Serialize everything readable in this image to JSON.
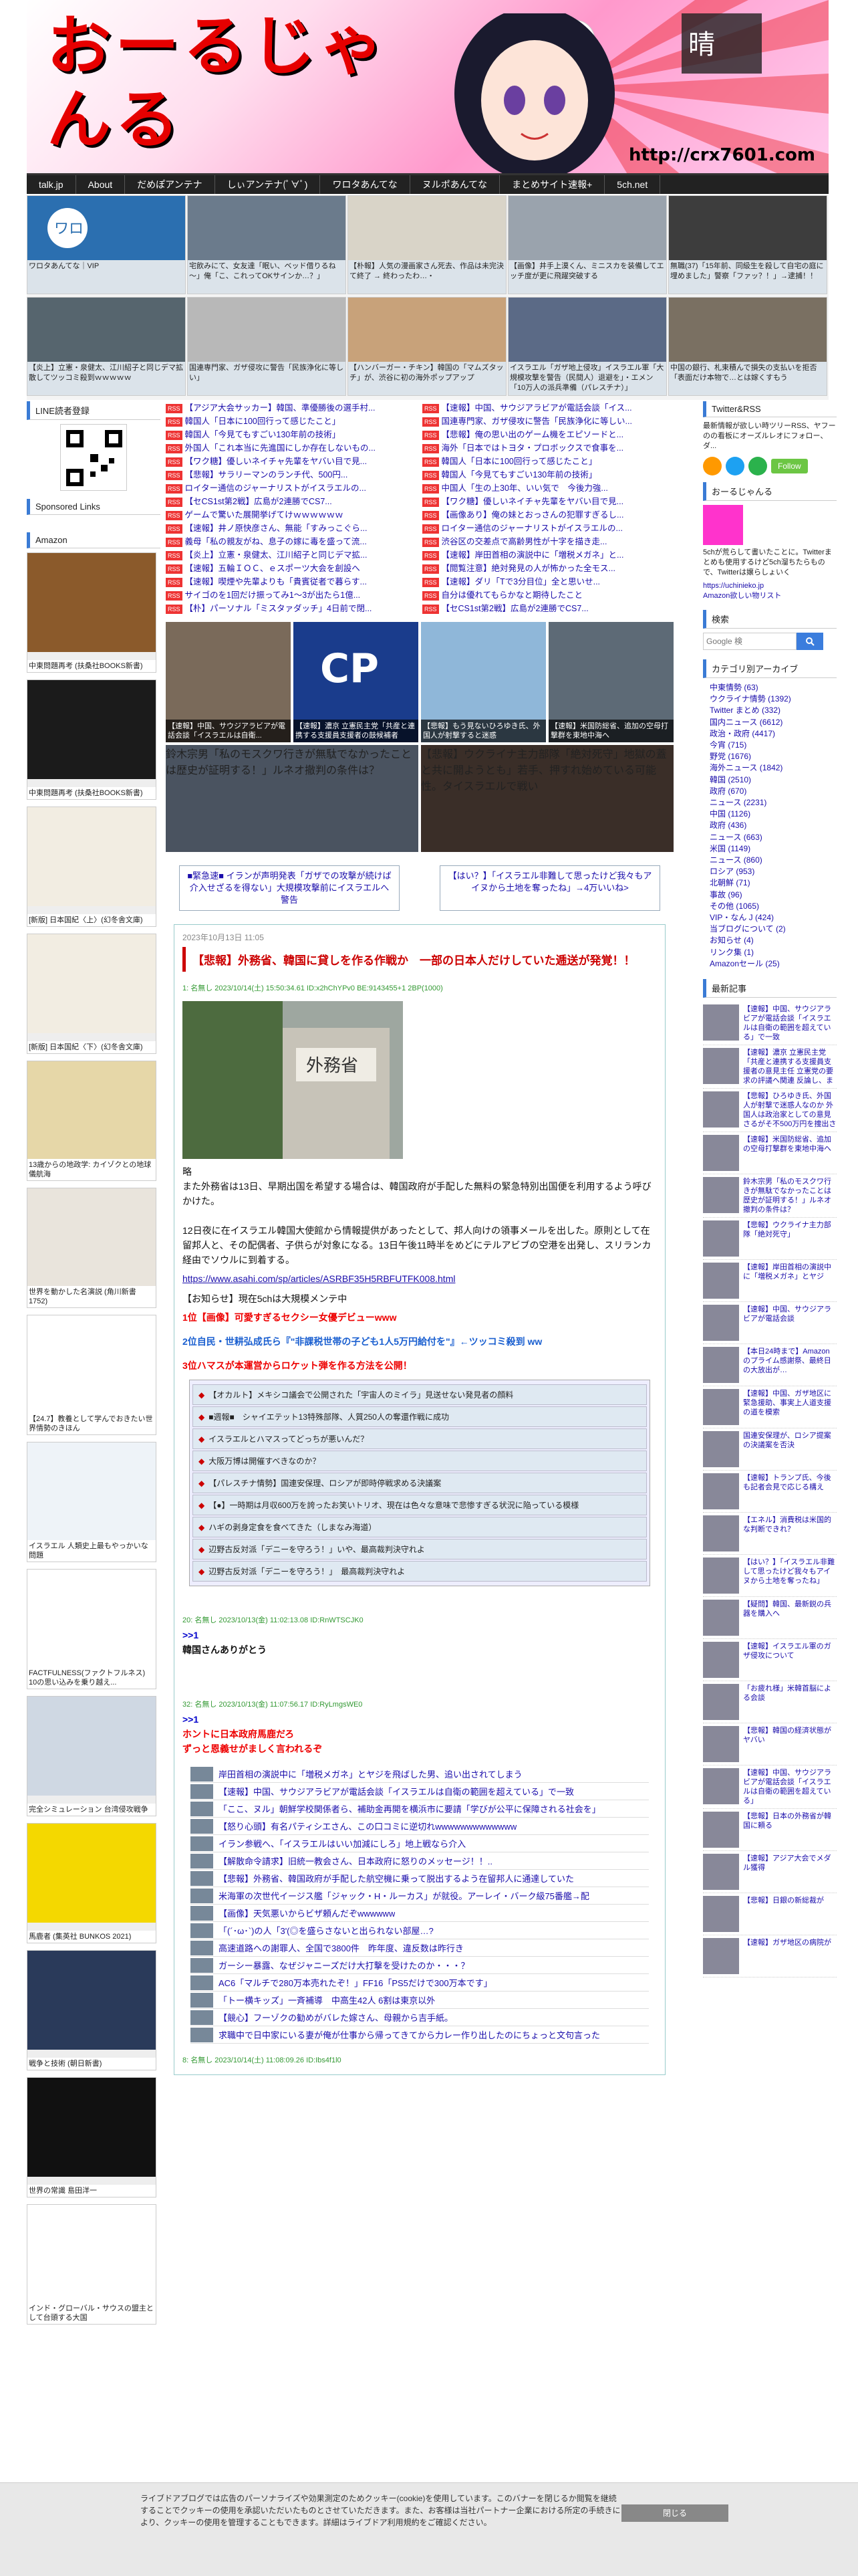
{
  "header": {
    "title": "おーるじゃんる",
    "url": "http://crx7601.com"
  },
  "nav": [
    "talk.jp",
    "About",
    "だめぽアンテナ",
    "しぃアンテナ(ﾟ∀ﾟ)",
    "ワロタあんてな",
    "ヌルポあんてな",
    "まとめサイト速報+",
    "5ch.net"
  ],
  "thumbs": [
    "ワロタあんてな｜VIP",
    "宅飲みにて、女友達「眠い、ベッド借りるね～」俺「こ、これってOKサインか…？」",
    "【朴報】人気の漫画家さん死去、作品は未完決て終了 → 終わったわ…・",
    "【画像】井手上漠くん、ミニスカを装備してエッチ度が更に飛躍突破する",
    "無職(37)「15年前、同級生を殺して自宅の庭に埋めました」警察「ファッ？！」→逮捕！！",
    "【炎上】立憲・泉健太、江川紹子と同じデマ拡散してツッコミ殺到ｗｗｗｗｗ",
    "国連専門家、ガザ侵攻に警告「民族浄化に等しい」",
    "【ハンバーガー・チキン】韓国の「マムズタッチ」が、渋谷に初の海外ポップアップ",
    "イスラエル「ガザ地上侵攻」イスラエル軍「大規模攻撃を警告（民間人）退避を」・エメン「10万人の派兵準備（パレスチナ）」",
    "中国の銀行、札束積んで損失の支払いを拒否「表面だけ本物で…とは嫁くすもう"
  ],
  "left": {
    "line_label": "LINE読者登録",
    "sponsored_label": "Sponsored Links",
    "amazon_label": "Amazon",
    "books": [
      "中東問題再考 (扶桑社BOOKS新書)",
      "中東問題再考 (扶桑社BOOKS新書)",
      "[新版] 日本国紀〈上〉(幻冬舎文庫)",
      "[新版] 日本国紀〈下〉(幻冬舎文庫)",
      "13歳からの地政学: カイゾクとの地球儀航海",
      "世界を動かした名演説 (角川新書 1752)",
      "【24.7】教養として学んでおきたい世界情勢のきほん",
      "イスラエル 人類史上最もやっかいな問題",
      "FACTFULNESS(ファクトフルネス) 10の思い込みを乗り越え...",
      "完全シミュレーション 台湾侵攻戦争",
      "馬鹿者 (集英社 BUNKOS 2021)",
      "戦争と技術 (朝日新書)",
      "世界の常識 島田洋一",
      "インド・グローバル・サウスの盟主として台頭する大国"
    ]
  },
  "headlines": {
    "left": [
      "【アジア大会サッカー】韓国、準優勝後の選手村...",
      "韓国人「日本に100回行って感じたこと」",
      "韓国人「今見てもすごい130年前の技術」",
      "外国人「これ本当に先進国にしか存在しないもの...",
      "【ワク糖】優しいネイチャ先輩をヤバい目で見...",
      "【悲報】サラリーマンのランチ代、500円...",
      "ロイター通信のジャーナリストがイスラエルの...",
      "【セCS1st第2戦】広島が2連勝でCS7...",
      "ゲームで驚いた展開挙げてけｗｗｗｗｗｗ",
      "【速報】井ノ原快彦さん、無能「すみっこぐら...",
      "義母「私の親友がね、息子の嫁に毒を盛って流...",
      "【炎上】立憲・泉健太、江川紹子と同じデマ拡...",
      "【速報】五輪ＩＯＣ、ｅスポーツ大会を創設へ",
      "【速報】喫煙や先輩よりも「貴賓従者で暮らす...",
      "サイゴのを1回だけ振ってみ1〜3が出たら1億...",
      "【朴】パーソナル「ミスタァダッチ」4日前で閉..."
    ],
    "right": [
      "【速報】中国、サウジアラビアが電話会談「イス...",
      "国連専門家、ガザ侵攻に警告「民族浄化に等しい...",
      "【悲報】俺の思い出のゲーム機をエピソードと...",
      "海外「日本ではトヨタ・プロボックスで食事を...",
      "韓国人「日本に100回行って感じたこと」",
      "韓国人「今見てもすごい130年前の技術」",
      "中国人「生の上30年、いい気で　今後力強...",
      "【ワク糖】優しいネイチャ先輩をヤバい目で見...",
      "【画像あり】俺の妹とおっさんの犯罪すぎるし...",
      "ロイター通信のジャーナリストがイスラエルの...",
      "渋谷区の交差点で高齢男性が十字を描き走...",
      "【速報】岸田首相の演説中に「増税メガネ」と...",
      "【閲覧注意】絶対発見の人が怖かった全モス...",
      "【速報】ダリ「Tで3分目位」全と思いせ...",
      "自分は優れてもらかなと期待したこと",
      "【セCS1st第2戦】広島が2連勝でCS7..."
    ]
  },
  "grid4": [
    "【速報】中国、サウジアラビアが電話会談「イスラエルは自衛...",
    "【速報】濃京 立憲民主党「共産と連携する支援員支援者の鼓候補者",
    "【悲報】もう見ないひろゆき氏、外国人が射撃すると迷惑",
    "【速報】米国防総省、追加の空母打撃群を東地中海へ"
  ],
  "grid2": [
    "鈴木宗男「私のモスクワ行きが無駄でなかったことは歴史が証明する！」ルネオ撤判の条件は？",
    "【悲報】ウクライナ主力部隊「絶対死守」地獄の蓋と共に開ようとも」若手、押すれ始めている可能性。タイスラエルで戦い"
  ],
  "pn": {
    "prev": "■緊急速■ イランが声明発表「ガザでの攻撃が続けば介入せざるを得ない」大規模攻撃前にイスラエルへ警告",
    "next": "【はい？】「イスラエル非難して思ったけど我々もアイヌから土地を奪ったね」→4万いいね>"
  },
  "article": {
    "date": "2023年10月13日 11:05",
    "title": "【悲報】外務省、韓国に貸しを作る作戦か　一部の日本人だけしていた逓送が発覚！！",
    "r1_header": "1: 名無し 2023/10/14(土) 15:50:34.61 ID:x2hChYPv0 BE:9143455+1 2BP(1000)",
    "r1_body": "略\nまた外務省は13日、早期出国を希望する場合は、韓国政府が手配した無料の緊急特別出国便を利用するよう呼びかけた。\n\n12日夜に在イスラエル韓国大使館から情報提供があったとして、邦人向けの領事メールを出した。原則として在留邦人と、その配偶者、子供らが対象になる。13日午後11時半をめどにテルアビブの空港を出発し、スリランカ経由でソウルに到着する。",
    "link": "https://www.asahi.com/sp/articles/ASRBF35H5RBFUTFK008.html",
    "notice": "【お知らせ】現在5chは大規模メンテ中",
    "n1": "1位【画像】可愛すぎるセクシー女優デビューwww",
    "n2": "2位自民・世耕弘成氏ら『\"非課税世帯の子ども1人5万円給付を\"』←ツッコミ殺到 ww",
    "n3": "3位ハマスが本運営からロケット弾を作る方法を公開！",
    "box": [
      "【オカルト】メキシコ議会で公開された「宇宙人のミイラ」見送せない発見者の顔料",
      "■週報■　シャイエテット13特殊部隊、人質250人の奪還作戦に成功",
      "イスラエルとハマスってどっちが悪いんだ？",
      "大阪万博は開催すべきなのか？",
      "【パレスチナ情勢】国連安保理、ロシアが即時停戦求める決議案",
      "【●】一時期は月収600万を誇ったお笑いトリオ、現在は色々な意味で悲惨すぎる状況に陥っている模様",
      "ハギの剥身定食を食べてきた（しまなみ海道）",
      "辺野古反対派「デニーを守ろう！」いや、最高裁判決守れよ",
      "辺野古反対派「デニーを守ろう！」　最高裁判決守れよ"
    ],
    "r2_header": "20: 名無し 2023/10/13(金) 11:02:13.08 ID:RnWTSCJK0",
    "r2_anchor": ">>1",
    "r2_body": "韓国さんありがとう",
    "r3_header": "32: 名無し 2023/10/13(金) 11:07:56.17 ID:RyLmgsWE0",
    "r3_anchor": ">>1",
    "r3_body": "ホントに日本政府馬鹿だろ\nずっと恩義せがましく言われるぞ",
    "related": [
      "岸田首相の演説中に「増税メガネ」とヤジを飛ばした男、追い出されてしまう",
      "【速報】中国、サウジアラビアが電話会談「イスラエルは自衛の範囲を超えている」で一致",
      "「ここ、ヌル」朝鮮学校関係者ら、補助金再開を横浜市に要請「学びが公平に保障される社会を」",
      "【怒り心頭】有名パティシエさん、この口コミに逆切れwwwwwwwwwwwww",
      "イラン参戦へ、「イスラエルはいい加減にしろ」地上戦なら介入",
      "【解散命令請求】旧統一教会さん、日本政府に怒りのメッセージ！！..",
      "【悲報】外務省、韓国政府が手配した航空機に乗って脱出するよう在留邦人に通達していた",
      "米海軍の次世代イージス艦「ジャック・H・ルーカス」が就役。アーレイ・バーク級75番艦→配",
      "【画像】天気悪いからビザ頼んだぞwwwwww",
      "「(´･ω･`)の人「3'(◎を盛らさないと出られない部屋…?",
      "高速道路への謝罪人、全国で3800件　昨年度、違反数は昨行き",
      "ガーシー暴露、なぜジャニーズだけ大打撃を受けたのか・・・？",
      "AC6「マルチで280万本売れたぞ！」FF16「PS5だけで300万本です」",
      "「トー横キッズ」一斉補導　中高生42人 6割は東京以外",
      "【競心】フーゾクの勧めがバレた嫁さん、母親から吉手紙。",
      "求職中で日中家にいる妻が俺が仕事から帰ってきてから力レー作り出したのにちょっと文句言った"
    ],
    "r4_header": "8: 名無し 2023/10/14(土) 11:08:09.26 ID:Ibs4f1l0"
  },
  "right": {
    "twitter_label": "Twitter&RSS",
    "twitter_text": "最新情報が欲しい時ツリーRSS、ヤフーのの看板にオーズルレオにフォロー、ダ...",
    "follow_label": "Follow",
    "allj_label": "おーるじゃんる",
    "allj_text": "5chが荒らして書いたことに。Twitterまとめも使用するけど5ch溜ちたらもので、Twitterは嬢らしょいく",
    "allj_link": "https://uchinieko.jp",
    "amazon_link": "Amazon欲しい物リスト",
    "search_label": "検索",
    "search_placeholder": "Google 検",
    "cat_label": "カテゴリ別アーカイブ",
    "cats": [
      "中東情勢 (63)",
      "ウクライナ情勢 (1392)",
      "Twitter まとめ (332)",
      "国内ニュース (6612)",
      "政治・政府 (4417)",
      "今宵 (715)",
      "野党 (1676)",
      "海外ニュース (1842)",
      "韓国 (2510)",
      "政府 (670)",
      "ニュース (2231)",
      "中国 (1126)",
      "政府 (436)",
      "ニュース (663)",
      "米国 (1149)",
      "ニュース (860)",
      "ロシア (953)",
      "北朝鮮 (71)",
      "事故 (96)",
      "その他 (1065)",
      "VIP・なん J (424)",
      "当ブログについて (2)",
      "お知らせ (4)",
      "リンク集 (1)",
      "Amazonセール (25)"
    ],
    "latest_label": "最新記事",
    "latest": [
      "【速報】中国、サウジアラビアが電話会談「イスラエルは自衛の範囲を超えている」で一致",
      "【速報】濃京 立憲民主党「共産と連携する支援員支援者の意見主任 立憲党の要求の評議へ関連 反論し、まだ内ダいWWWWW",
      "【悲報】ひろゆき氏、外国人が射撃で迷惑人なのか 外国人は政治家としての意見さるがそ不500万円を捜出されず悔しいうで",
      "【速報】米国防総省、追加の空母打撃群を東地中海へ",
      "鈴木宗男「私のモスクワ行きが無駄でなかったことは歴史が証明する！」ルネオ撤判の条件は？",
      "【悲報】ウクライナ主力部隊「絶対死守」",
      "【速報】岸田首相の演説中に「増税メガネ」とヤジ",
      "【速報】中国、サウジアラビアが電話会談",
      "【本日24時まで】Amazonのプライム感謝祭、最終日の大放出が…",
      "【速報】中国、ガザ地区に緊急援助、事実上人道支援の道を模索",
      "国連安保理が、ロシア提案の決議案を否決",
      "【速報】トランプ氏、今後も記者会見で応じる構え",
      "【エネル】消費税は米国的な判断できれ？",
      "【はい？】「イスラエル非難して思ったけど我々もアイヌから土地を奪ったね」",
      "【疑問】韓国、最新鋭の兵器を購入へ",
      "【速報】イスラエル軍のガザ侵攻について",
      "「お疲れ様」米韓首脳による会談",
      "【悲報】韓国の経済状態がヤバい",
      "【速報】中国、サウジアラビアが電話会談「イスラエルは自衛の範囲を超えている」",
      "【悲報】日本の外務省が韓国に頼る",
      "【速報】アジア大会でメダル獲得",
      "【悲報】日銀の新総裁が",
      "【速報】ガザ地区の病院が"
    ]
  },
  "cookie": {
    "text": "ライブドアブログでは広告のパーソナライズや効果測定のためクッキー(cookie)を使用しています。このバナーを閉じるか閲覧を継続することでクッキーの使用を承認いただいたものとさせていただきます。また、お客様は当社パートナー企業における所定の手続きにより、クッキーの使用を管理することもできます。詳細はライブドア利用規約をご確認ください。",
    "close": "閉じる"
  }
}
